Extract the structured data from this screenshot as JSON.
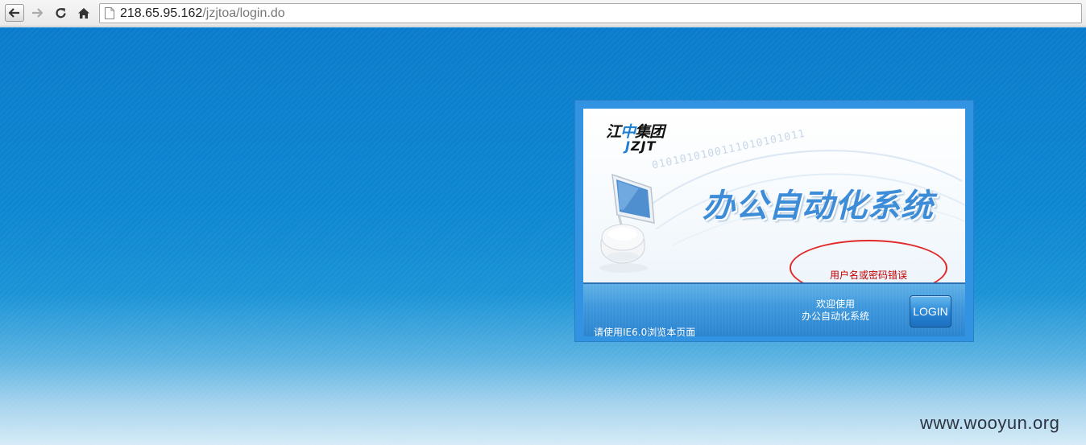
{
  "browser": {
    "url_host": "218.65.95.162",
    "url_path": "/jzjtoa/login.do",
    "icons": [
      "back-arrow-icon",
      "forward-arrow-icon",
      "reload-icon",
      "home-icon",
      "page-icon"
    ]
  },
  "login": {
    "logo_cn_a": "江",
    "logo_cn_b": "中",
    "logo_cn_c": "集团",
    "logo_en_a": "J",
    "logo_en_b": "ZJT",
    "binary_strip": "0101010100111010101011",
    "system_title": "办公自动化系统",
    "error_message": "用户名或密码错误",
    "welcome_line1": "欢迎使用",
    "welcome_line2": "办公自动化系统",
    "login_button": "LOGIN",
    "ie_note": "请使用IE6.0浏览本页面"
  },
  "watermark": "www.wooyun.org",
  "colors": {
    "page_blue": "#0d86d1",
    "panel_blue": "#3293e2",
    "error_red": "#c00000",
    "annotation_red": "#e12a2a"
  }
}
